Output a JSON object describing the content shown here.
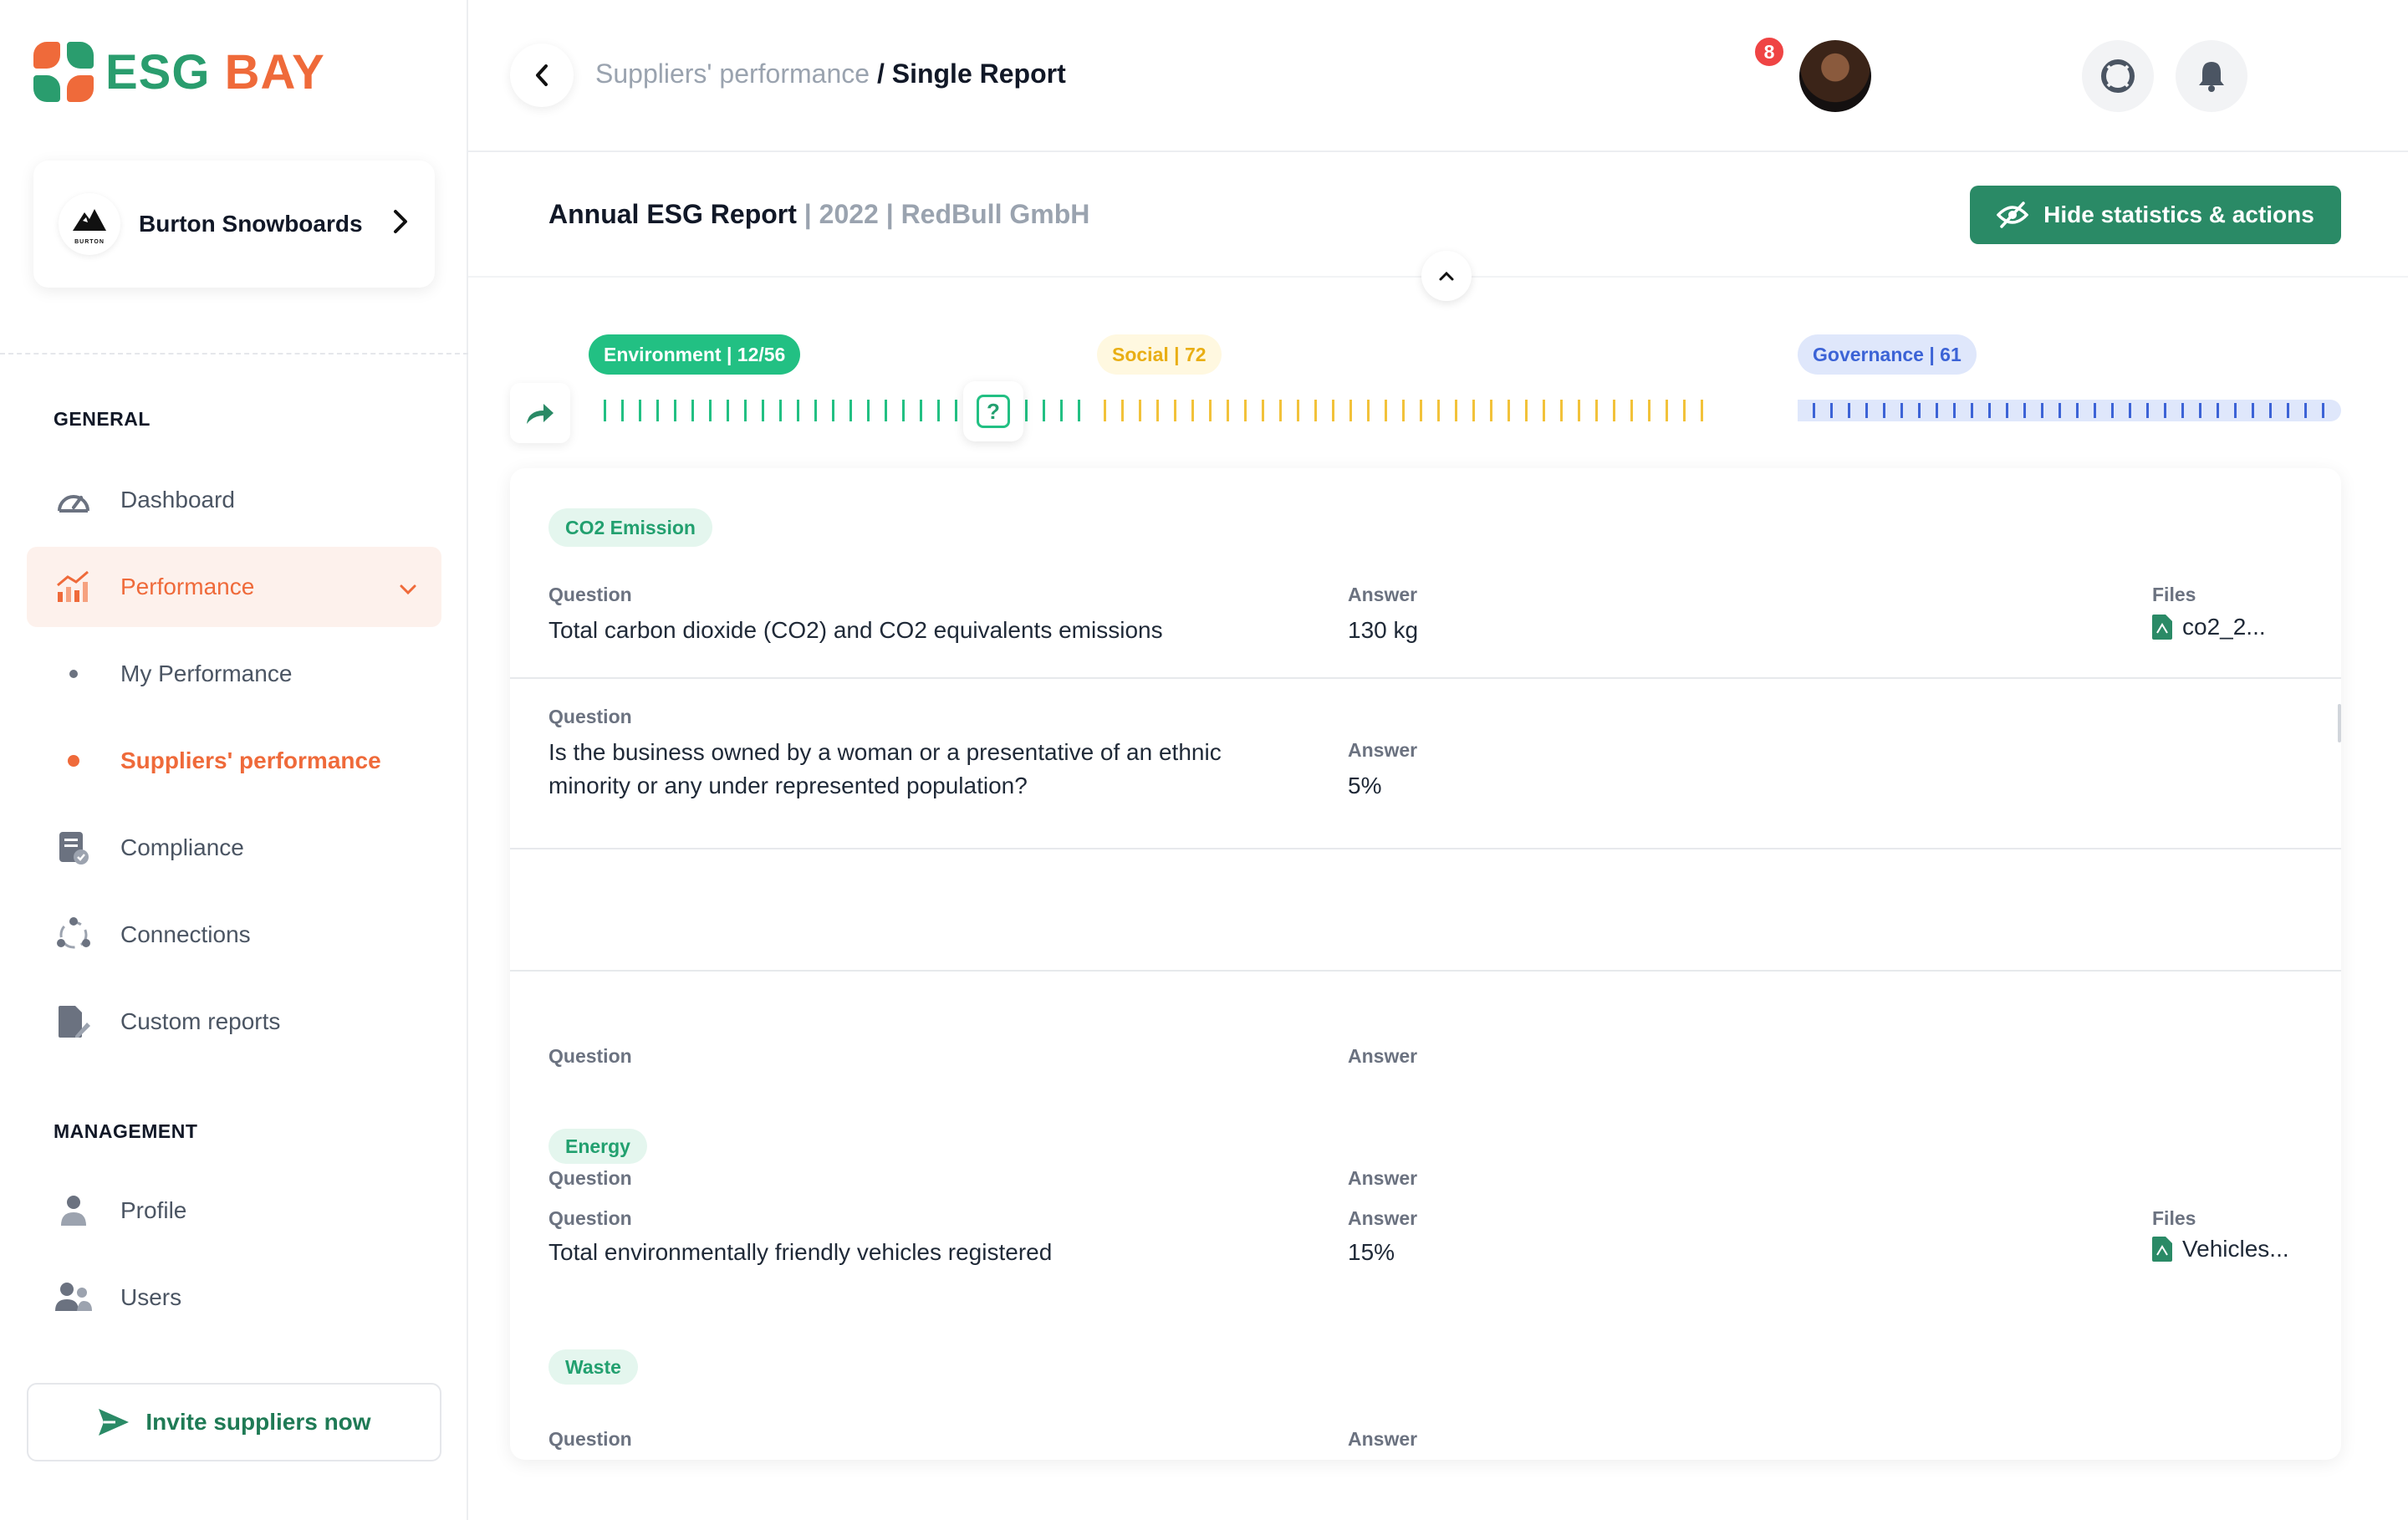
{
  "brand": {
    "part1": "ESG",
    "part2": "BAY"
  },
  "company": {
    "name": "Burton Snowboards",
    "logo_text": "BURTON"
  },
  "nav": {
    "general_title": "GENERAL",
    "management_title": "MANAGEMENT",
    "dashboard": "Dashboard",
    "performance": "Performance",
    "my_performance": "My Performance",
    "suppliers_performance": "Suppliers' performance",
    "compliance": "Compliance",
    "connections": "Connections",
    "custom_reports": "Custom reports",
    "profile": "Profile",
    "users": "Users",
    "invite": "Invite suppliers now"
  },
  "header": {
    "breadcrumb_parent": "Suppliers' performance",
    "breadcrumb_current": "/ Single Report",
    "notification_count": "8"
  },
  "report": {
    "title": "Annual ESG Report",
    "year": "| 2022 |",
    "company": "RedBull GmbH",
    "hide_button": "Hide statistics & actions"
  },
  "progress": {
    "environment": "Environment | 12/56",
    "social": "Social | 72",
    "governance": "Governance | 61",
    "marker": "?"
  },
  "colors": {
    "primary": "#2a8a66",
    "accent": "#ef6a3a",
    "environment": "#22c083",
    "social": "#f2c23a",
    "governance": "#3c63d6"
  },
  "content": {
    "co2_category": "CO2 Emission",
    "question_label": "Question",
    "answer_label": "Answer",
    "files_label": "Files",
    "q1": "Total carbon dioxide (CO2) and CO2 equivalents emissions",
    "a1": "130 kg",
    "f1": "co2_2...",
    "q2_line1": "Is the business owned by a woman or a presentative of an ethnic",
    "q2_line2": "minority or any under represented population?",
    "a2": "5%",
    "energy_category": "Energy",
    "q3": "Total environmentally friendly vehicles registered",
    "a3": "15%",
    "f3": "Vehicles...",
    "waste_category": "Waste"
  }
}
